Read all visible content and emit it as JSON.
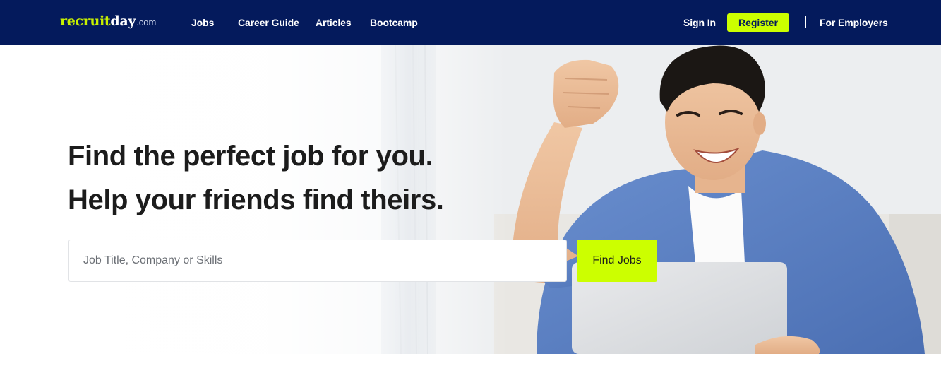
{
  "header": {
    "logo": {
      "part1": "recruit",
      "part2": "day",
      "suffix": ".com"
    },
    "nav": {
      "jobs": "Jobs",
      "career_guide": "Career Guide",
      "articles": "Articles",
      "bootcamp": "Bootcamp"
    },
    "sign_in": "Sign In",
    "register": "Register",
    "for_employers": "For Employers"
  },
  "hero": {
    "title_line1": "Find the perfect job for you.",
    "title_line2": "Help your friends find theirs.",
    "search_placeholder": "Job Title, Company or Skills",
    "search_value": "",
    "find_button": "Find Jobs"
  },
  "colors": {
    "header_bg": "#041a5c",
    "accent": "#ccff00",
    "heading_text": "#1c1c1c"
  }
}
